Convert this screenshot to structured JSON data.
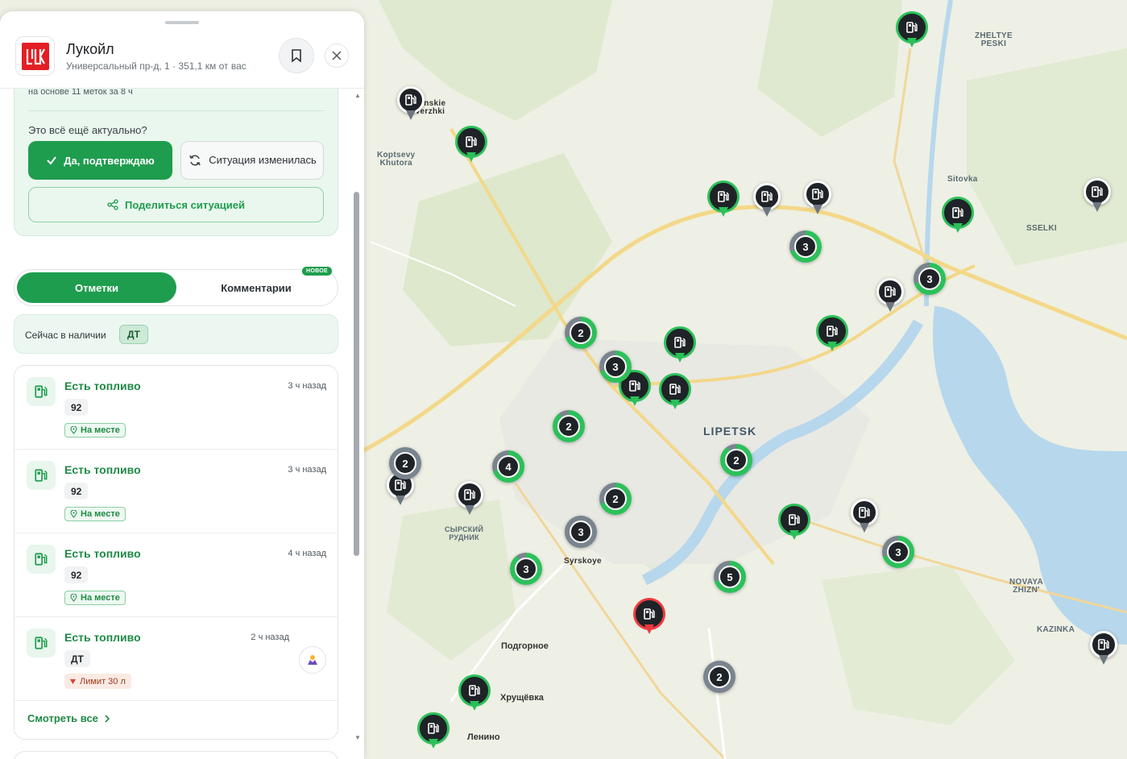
{
  "header": {
    "title": "Лукойл",
    "subtitle": "Универсальный пр-д, 1 · 351,1 км от вас"
  },
  "confirm": {
    "based_on": "на основе 11 меток за 8 ч",
    "question": "Это всё ещё актуально?",
    "yes_label": "Да, подтверждаю",
    "changed_label": "Ситуация изменилась",
    "share_label": "Поделиться ситуацией"
  },
  "tabs": {
    "marks": "Отметки",
    "comments": "Комментарии",
    "new_badge": "НОВОЕ"
  },
  "available": {
    "label": "Сейчас в наличии",
    "fuel": "ДТ"
  },
  "reports": [
    {
      "title": "Есть топливо",
      "time": "3 ч назад",
      "fuel": "92",
      "tag": "На месте"
    },
    {
      "title": "Есть топливо",
      "time": "3 ч назад",
      "fuel": "92",
      "tag": "На месте"
    },
    {
      "title": "Есть топливо",
      "time": "4 ч назад",
      "fuel": "92",
      "tag": "На месте"
    },
    {
      "title": "Есть топливо",
      "time": "2 ч назад",
      "fuel": "ДТ",
      "limit": "Лимит 30 л"
    }
  ],
  "see_all": "Смотреть все",
  "map": {
    "places": {
      "zheltye_peski": "ZHELTYE\nPESKI",
      "kaminskie": "minskie\nVerzhki",
      "koptsevy": "Koptsevy\nKhutora",
      "sitovka": "Sitovka",
      "sselki": "SSELKI",
      "lipetsk": "LIPETSK",
      "syrsky": "СЫРСКИЙ\nРУДНИК",
      "syrskoye": "Syrskoye",
      "novaya": "NOVAYA\nZHIZN'",
      "kazinka": "KAZINKA",
      "podgornoe": "Подгорное",
      "khrushchevka": "Хрущёвка",
      "lenino": "Ленино"
    },
    "clusters": [
      "3",
      "3",
      "2",
      "3",
      "2",
      "4",
      "2",
      "2",
      "2",
      "3",
      "3",
      "3",
      "5",
      "2"
    ]
  },
  "colors": {
    "accent": "#1f9d4e",
    "brand": "#e31e24",
    "alert": "#ef3b40"
  }
}
